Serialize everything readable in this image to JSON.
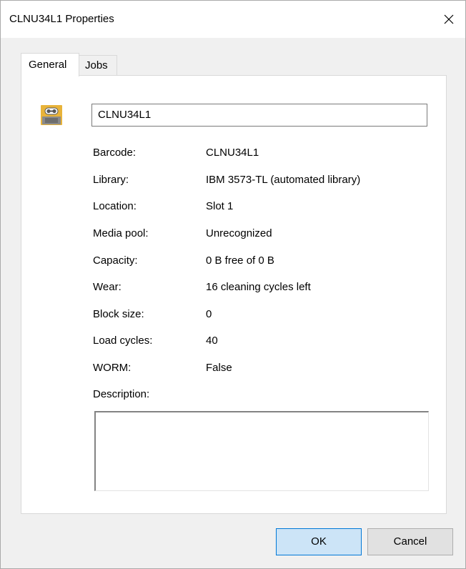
{
  "window": {
    "title": "CLNU34L1 Properties",
    "close_icon": "close-icon"
  },
  "tabs": [
    {
      "label": "General",
      "selected": true
    },
    {
      "label": "Jobs",
      "selected": false
    }
  ],
  "general": {
    "icon": "tape-cartridge-icon",
    "name_value": "CLNU34L1",
    "properties": [
      {
        "label": "Barcode:",
        "value": "CLNU34L1"
      },
      {
        "label": "Library:",
        "value": "IBM 3573-TL (automated library)"
      },
      {
        "label": "Location:",
        "value": "Slot 1"
      },
      {
        "label": "Media pool:",
        "value": "Unrecognized"
      },
      {
        "label": "Capacity:",
        "value": "0 B free of 0 B"
      },
      {
        "label": "Wear:",
        "value": "16 cleaning cycles left"
      },
      {
        "label": "Block size:",
        "value": "0"
      },
      {
        "label": "Load cycles:",
        "value": "40"
      },
      {
        "label": "WORM:",
        "value": "False"
      }
    ],
    "description_label": "Description:",
    "description_value": ""
  },
  "buttons": {
    "ok": "OK",
    "cancel": "Cancel"
  },
  "colors": {
    "ok_button_bg": "#cce4f7",
    "ok_button_border": "#0078d7",
    "tape_icon": "#e8b33a"
  }
}
